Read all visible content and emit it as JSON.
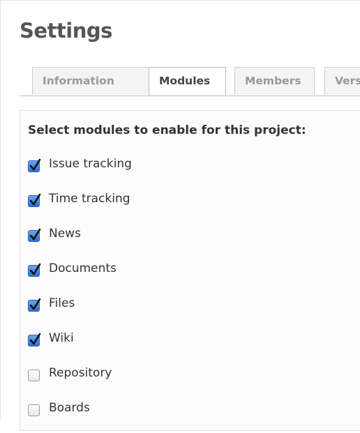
{
  "header": {
    "title": "Settings"
  },
  "tabs": [
    {
      "label": "Information",
      "selected": false
    },
    {
      "label": "Modules",
      "selected": true
    },
    {
      "label": "Members",
      "selected": false
    },
    {
      "label": "Vers",
      "selected": false
    }
  ],
  "modules": {
    "heading": "Select modules to enable for this project:",
    "items": [
      {
        "label": "Issue tracking",
        "checked": true
      },
      {
        "label": "Time tracking",
        "checked": true
      },
      {
        "label": "News",
        "checked": true
      },
      {
        "label": "Documents",
        "checked": true
      },
      {
        "label": "Files",
        "checked": true
      },
      {
        "label": "Wiki",
        "checked": true
      },
      {
        "label": "Repository",
        "checked": false
      },
      {
        "label": "Boards",
        "checked": false
      }
    ]
  },
  "colors": {
    "checked_fill": "#2d6fd8",
    "check_mark": "#111111",
    "title": "#555555"
  },
  "icons": {
    "checked": "checkmark-icon"
  }
}
